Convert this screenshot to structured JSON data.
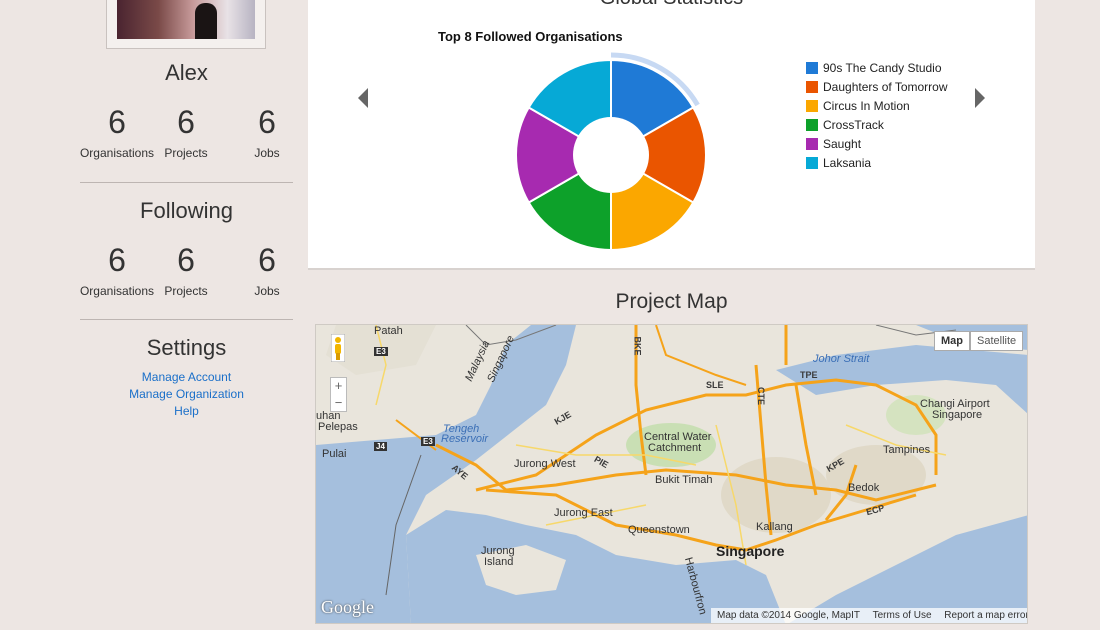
{
  "profile": {
    "name": "Alex",
    "stats": [
      {
        "value": "6",
        "label": "Organisations"
      },
      {
        "value": "6",
        "label": "Projects"
      },
      {
        "value": "6",
        "label": "Jobs"
      }
    ]
  },
  "following": {
    "title": "Following",
    "stats": [
      {
        "value": "6",
        "label": "Organisations"
      },
      {
        "value": "6",
        "label": "Projects"
      },
      {
        "value": "6",
        "label": "Jobs"
      }
    ]
  },
  "settings": {
    "title": "Settings",
    "links": [
      "Manage Account",
      "Manage Organization",
      "Help"
    ]
  },
  "global_statistics": {
    "title": "Global Statistics"
  },
  "chart_data": {
    "type": "pie",
    "title": "Top 8 Followed Organisations",
    "categories": [
      "90s The Candy Studio",
      "Daughters of Tomorrow",
      "Circus In Motion",
      "CrossTrack",
      "Saught",
      "Laksania"
    ],
    "values": [
      1,
      1,
      1,
      1,
      1,
      1
    ],
    "colors": [
      "#1f7ad6",
      "#ea5500",
      "#fba700",
      "#0da12a",
      "#a72ab0",
      "#06a9d6"
    ],
    "donut": true,
    "highlighted": "90s The Candy Studio"
  },
  "project_map": {
    "title": "Project Map",
    "map_type_buttons": [
      "Map",
      "Satellite"
    ],
    "zoom": [
      "+",
      "−"
    ],
    "labels": {
      "cities": [
        "Singapore"
      ],
      "places": [
        "Patah",
        "Johor Strait",
        "Changi Airport",
        "Singapore",
        "Tengeh",
        "Reservoir",
        "Central Water",
        "Catchment",
        "Jurong West",
        "Bukit Timah",
        "Tampines",
        "Bedok",
        "Jurong East",
        "Kallang",
        "Queenstown",
        "Jurong",
        "Island",
        "Pelepas",
        "uhan",
        "Pulai",
        "Harbourfron"
      ],
      "roads": [
        "BKE",
        "SLE",
        "TPE",
        "KJE",
        "PIE",
        "CTE",
        "KPE",
        "AYE",
        "ECP",
        "Malaysia",
        "Singapore",
        "E3",
        "J4"
      ]
    },
    "brand": "Google",
    "attribution": "Map data ©2014 Google, MapIT",
    "terms": "Terms of Use",
    "report": "Report a map error"
  }
}
